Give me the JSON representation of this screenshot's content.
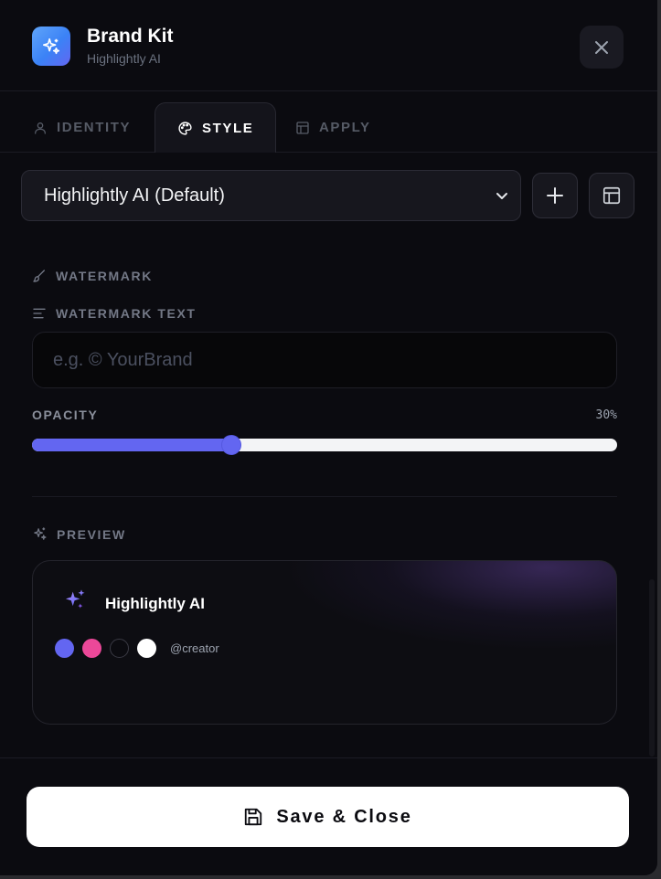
{
  "header": {
    "title": "Brand Kit",
    "subtitle": "Highlightly AI",
    "app_icon": "sparkles-icon",
    "close_icon": "close-icon"
  },
  "tabs": [
    {
      "label": "IDENTITY",
      "icon": "user-icon",
      "active": false
    },
    {
      "label": "STYLE",
      "icon": "palette-icon",
      "active": true
    },
    {
      "label": "APPLY",
      "icon": "layout-icon",
      "active": false
    }
  ],
  "preset": {
    "selected": "Highlightly AI (Default)",
    "add_icon": "plus-icon",
    "template_icon": "layout-icon"
  },
  "watermark": {
    "section_label": "WATERMARK",
    "text_label": "WATERMARK TEXT",
    "text_value": "",
    "text_placeholder": "e.g. © YourBrand",
    "opacity_label": "OPACITY",
    "opacity_display": "30%",
    "opacity_level": 0.34
  },
  "preview": {
    "section_label": "PREVIEW",
    "brand_name": "Highlightly AI",
    "handle": "@creator",
    "swatches": [
      "#6366f1",
      "#ec4899",
      "#0b0b10",
      "#ffffff"
    ]
  },
  "footer": {
    "save_label": "Save & Close",
    "save_icon": "save-icon"
  },
  "colors": {
    "accent": "#6366f1",
    "pink": "#ec4899",
    "background": "#0b0b10"
  }
}
